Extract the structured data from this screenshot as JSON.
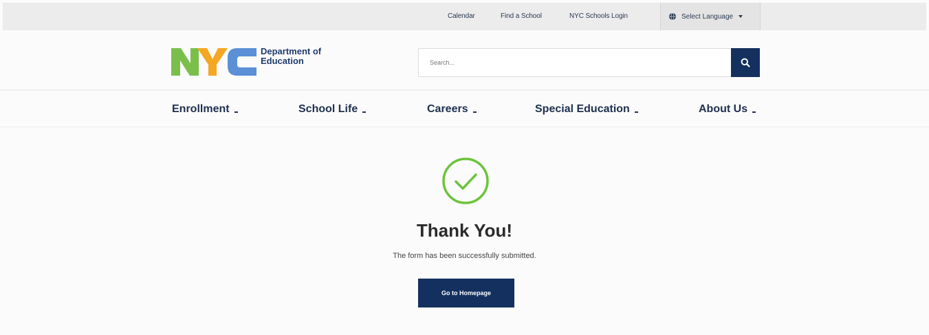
{
  "utility_bar": {
    "links": {
      "calendar": "Calendar",
      "find_school": "Find a School",
      "login": "NYC Schools Login"
    },
    "language": {
      "label": "Select Language",
      "icon": "globe-icon",
      "caret": "caret-down-icon"
    }
  },
  "header": {
    "logo": {
      "letters": "NYC",
      "line1": "Department of",
      "line2": "Education",
      "colors": {
        "n": "#7bbf4b",
        "y": "#f5a623",
        "c": "#5b8fd6"
      }
    },
    "search": {
      "placeholder": "Search...",
      "icon": "search-icon",
      "button_color": "#13305e"
    }
  },
  "nav": {
    "items": [
      {
        "label": "Enrollment"
      },
      {
        "label": "School Life"
      },
      {
        "label": "Careers"
      },
      {
        "label": "Special Education"
      },
      {
        "label": "About Us"
      }
    ]
  },
  "content": {
    "icon": "check-circle-icon",
    "icon_color": "#6cc33b",
    "title": "Thank You!",
    "message": "The form has been successfully submitted.",
    "button_label": "Go to Homepage",
    "button_color": "#13305e"
  }
}
